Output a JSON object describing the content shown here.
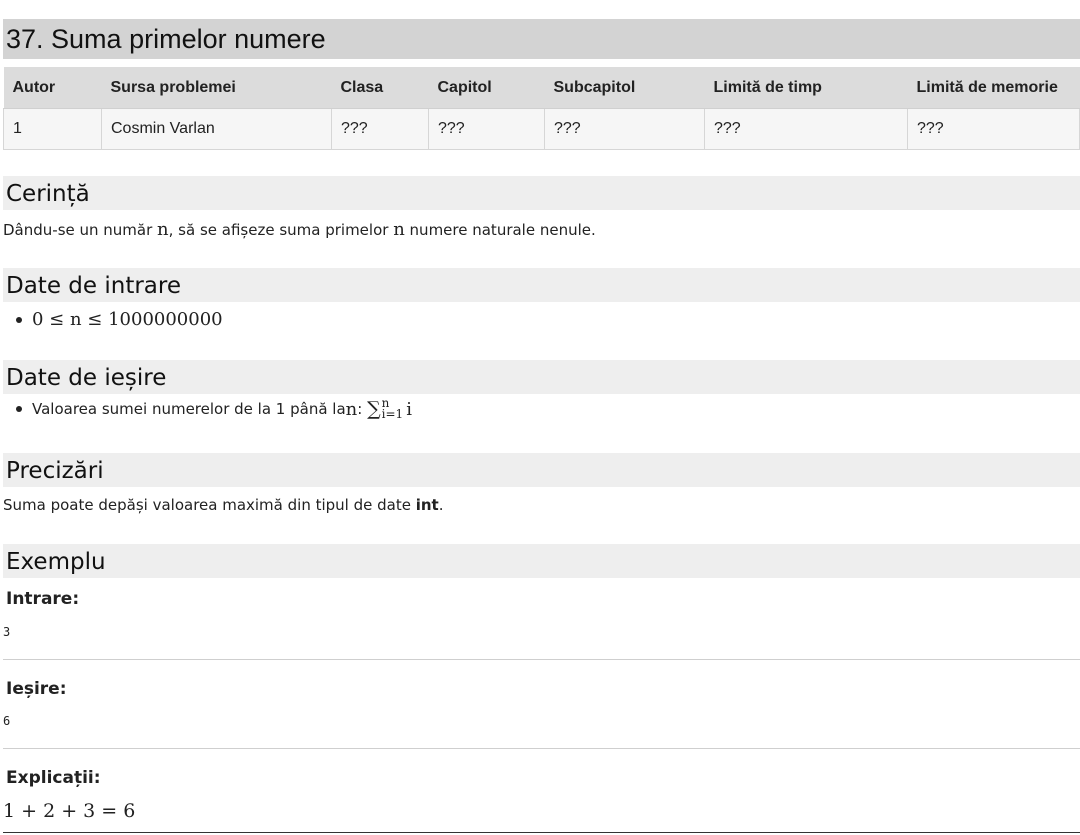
{
  "title": "37. Suma primelor numere",
  "meta_table": {
    "headers": [
      "Autor",
      "Sursa problemei",
      "Clasa",
      "Capitol",
      "Subcapitol",
      "Limită de timp",
      "Limită de memorie"
    ],
    "row": [
      "1",
      "Cosmin Varlan",
      "???",
      "???",
      "???",
      "???",
      "???"
    ]
  },
  "sections": {
    "cerinta": {
      "heading": "Cerință",
      "text_before": "Dându-se un număr ",
      "var1": "n",
      "text_middle": ", să se afișeze suma primelor ",
      "var2": "n",
      "text_after": " numere naturale nenule."
    },
    "date_intrare": {
      "heading": "Date de intrare",
      "item": "0 ≤ n ≤ 1000000000"
    },
    "date_iesire": {
      "heading": "Date de ieșire",
      "item_text": "Valoarea sumei numerelor de la 1 până la ",
      "item_var": "n",
      "sum_symbol": "∑",
      "sum_upper": "n",
      "sum_lower": "i=1",
      "sum_term": "i"
    },
    "precizari": {
      "heading": "Precizări",
      "text_before": "Suma poate depăși valoarea maximă din tipul de date ",
      "bold": "int",
      "text_after": "."
    },
    "exemplu": {
      "heading": "Exemplu",
      "input_label": "Intrare:",
      "input_value": "3",
      "output_label": "Ieșire:",
      "output_value": "6",
      "explanation_label": "Explicații:",
      "explanation_value": "1 + 2 + 3 = 6"
    }
  }
}
